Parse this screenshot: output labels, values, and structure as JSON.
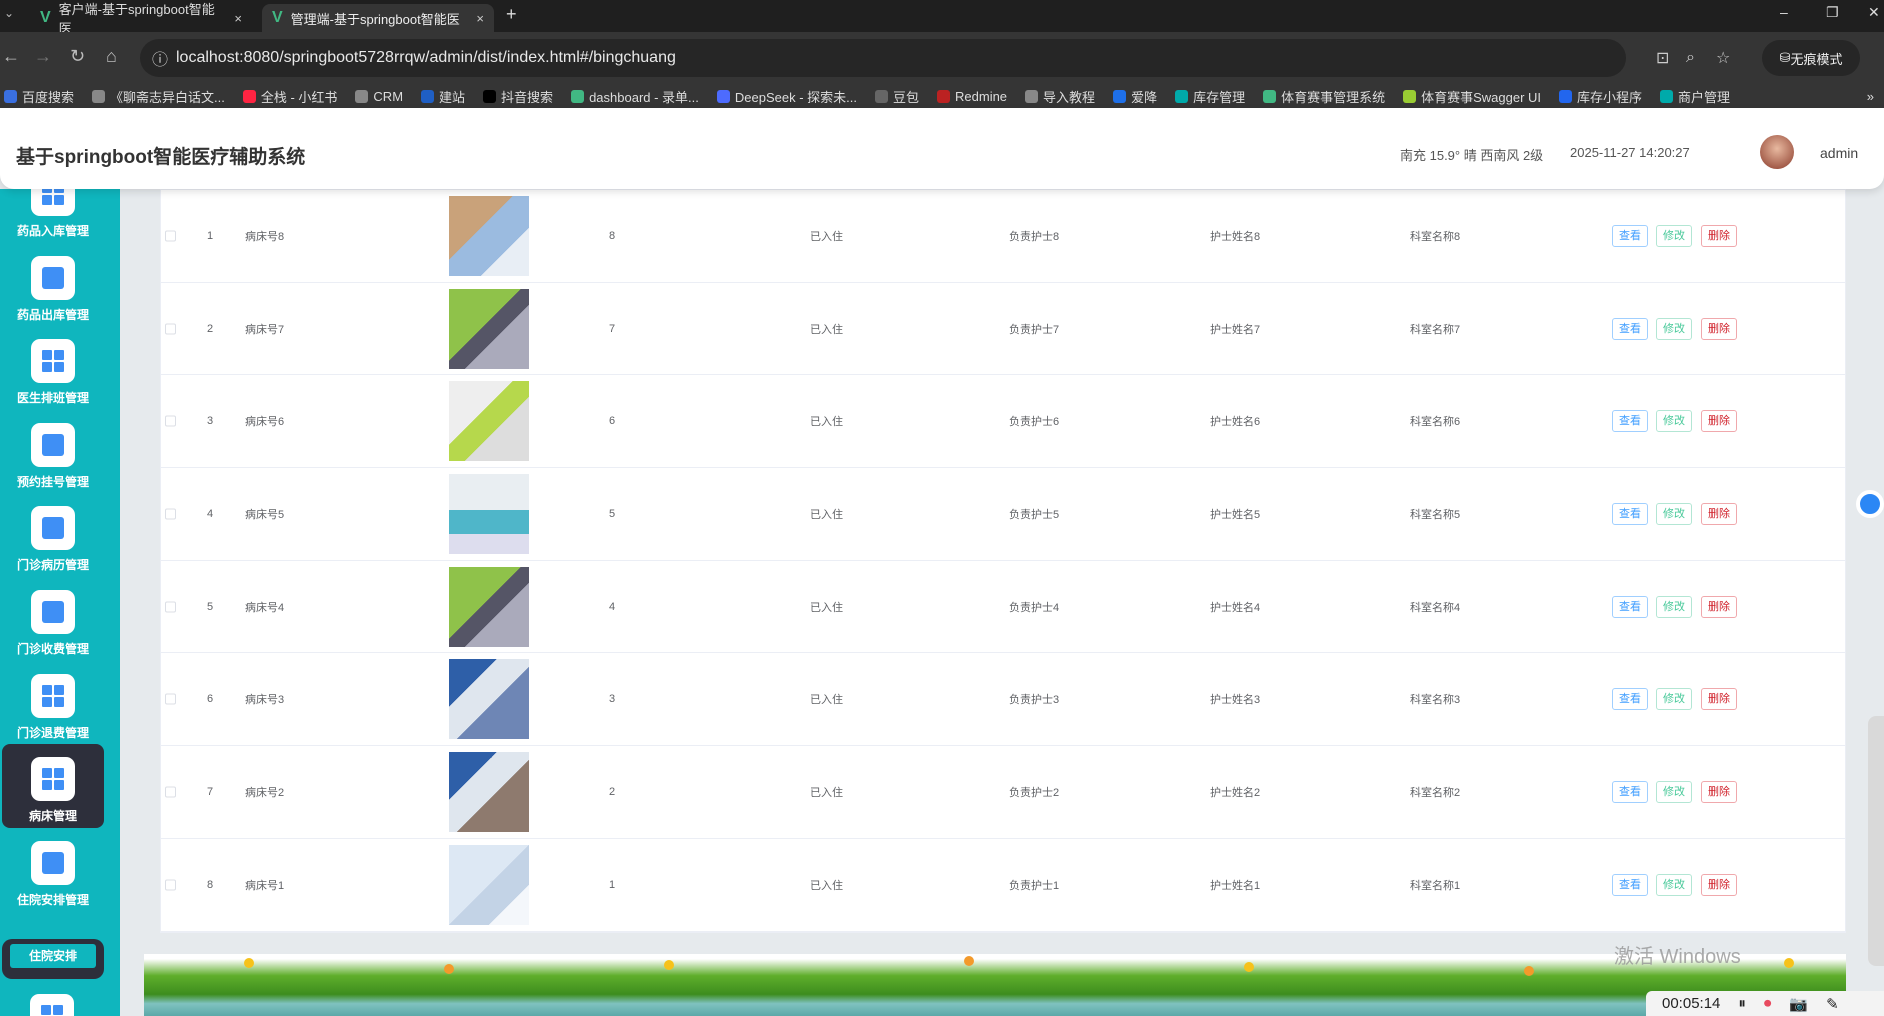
{
  "browser": {
    "tabs": [
      {
        "label": "客户端-基于springboot智能医"
      },
      {
        "label": "管理端-基于springboot智能医"
      }
    ],
    "url": "localhost:8080/springboot5728rrqw/admin/dist/index.html#/bingchuang",
    "incognito": "无痕模式",
    "bookmarks": [
      "百度搜索",
      "《聊斋志异白话文...",
      "全栈 - 小红书",
      "CRM",
      "建站",
      "抖音搜索",
      "dashboard - 录单...",
      "DeepSeek - 探索未...",
      "豆包",
      "Redmine",
      "导入教程",
      "爱降",
      "库存管理",
      "体育赛事管理系统",
      "体育赛事Swagger UI",
      "库存小程序",
      "商户管理"
    ]
  },
  "header": {
    "title": "基于springboot智能医疗辅助系统",
    "weather": "南充  15.9°  晴  西南风  2级",
    "datetime": "2025-11-27 14:20:27",
    "user": "admin"
  },
  "sidebar": {
    "items": [
      {
        "label": "药品入库管理",
        "icon": "grid"
      },
      {
        "label": "药品出库管理",
        "icon": "user"
      },
      {
        "label": "医生排班管理",
        "icon": "grid"
      },
      {
        "label": "预约挂号管理",
        "icon": "bulb"
      },
      {
        "label": "门诊病历管理",
        "icon": "clipboard"
      },
      {
        "label": "门诊收费管理",
        "icon": "send"
      },
      {
        "label": "门诊退费管理",
        "icon": "grid"
      },
      {
        "label": "病床管理",
        "icon": "grid",
        "active": true
      },
      {
        "label": "住院安排管理",
        "icon": "briefcase"
      }
    ],
    "subitem": "住院安排"
  },
  "table": {
    "buttons": {
      "view": "查看",
      "edit": "修改",
      "delete": "删除"
    },
    "rows": [
      {
        "index": "1",
        "bed": "病床号8",
        "number": "8",
        "status": "已入住",
        "nurse": "负责护士8",
        "nurse_name": "护士姓名8",
        "dept": "科室名称8"
      },
      {
        "index": "2",
        "bed": "病床号7",
        "number": "7",
        "status": "已入住",
        "nurse": "负责护士7",
        "nurse_name": "护士姓名7",
        "dept": "科室名称7"
      },
      {
        "index": "3",
        "bed": "病床号6",
        "number": "6",
        "status": "已入住",
        "nurse": "负责护士6",
        "nurse_name": "护士姓名6",
        "dept": "科室名称6"
      },
      {
        "index": "4",
        "bed": "病床号5",
        "number": "5",
        "status": "已入住",
        "nurse": "负责护士5",
        "nurse_name": "护士姓名5",
        "dept": "科室名称5"
      },
      {
        "index": "5",
        "bed": "病床号4",
        "number": "4",
        "status": "已入住",
        "nurse": "负责护士4",
        "nurse_name": "护士姓名4",
        "dept": "科室名称4"
      },
      {
        "index": "6",
        "bed": "病床号3",
        "number": "3",
        "status": "已入住",
        "nurse": "负责护士3",
        "nurse_name": "护士姓名3",
        "dept": "科室名称3"
      },
      {
        "index": "7",
        "bed": "病床号2",
        "number": "2",
        "status": "已入住",
        "nurse": "负责护士2",
        "nurse_name": "护士姓名2",
        "dept": "科室名称2"
      },
      {
        "index": "8",
        "bed": "病床号1",
        "number": "1",
        "status": "已入住",
        "nurse": "负责护士1",
        "nurse_name": "护士姓名1",
        "dept": "科室名称1"
      }
    ]
  },
  "overlay": {
    "watermark": "激活 Windows",
    "recorder_time": "00:05:14"
  }
}
